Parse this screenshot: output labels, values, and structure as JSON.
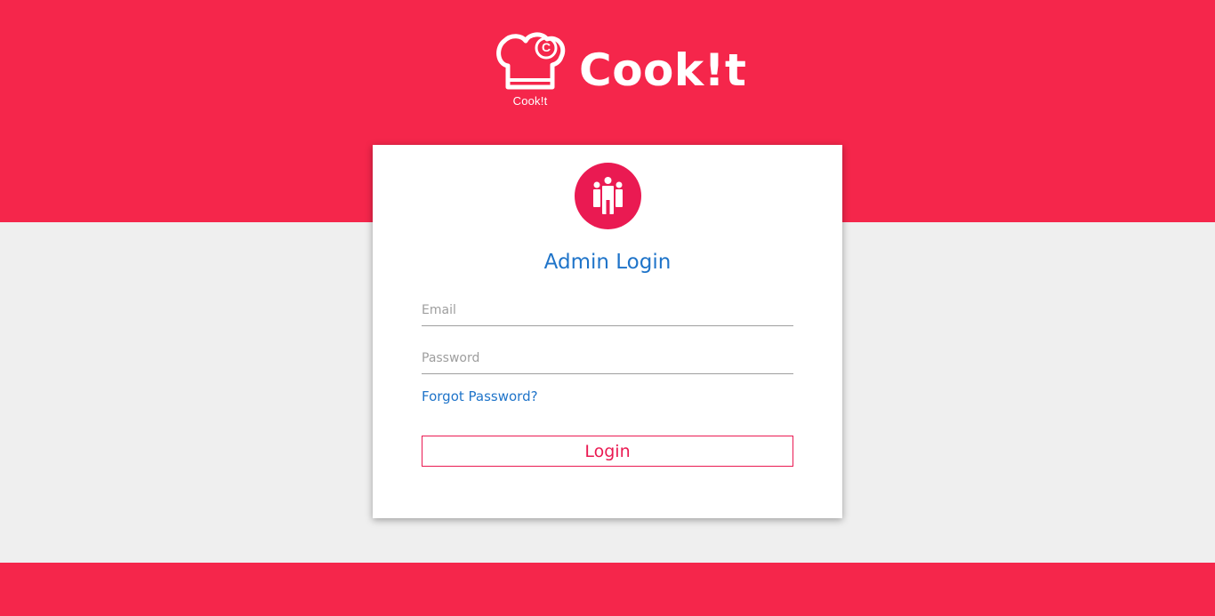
{
  "brand": {
    "name": "Cook!t",
    "logo_caption": "Cook!t",
    "logo_badge_letter": "C"
  },
  "login_card": {
    "avatar_icon": "users-group-icon",
    "title": "Admin Login",
    "email_placeholder": "Email",
    "email_value": "",
    "password_placeholder": "Password",
    "password_value": "",
    "forgot_password_label": "Forgot Password?",
    "login_button_label": "Login"
  },
  "colors": {
    "brand_red": "#f5264b",
    "accent_pink": "#ea1a52",
    "link_blue": "#1f74c9",
    "page_background": "#efefef"
  }
}
